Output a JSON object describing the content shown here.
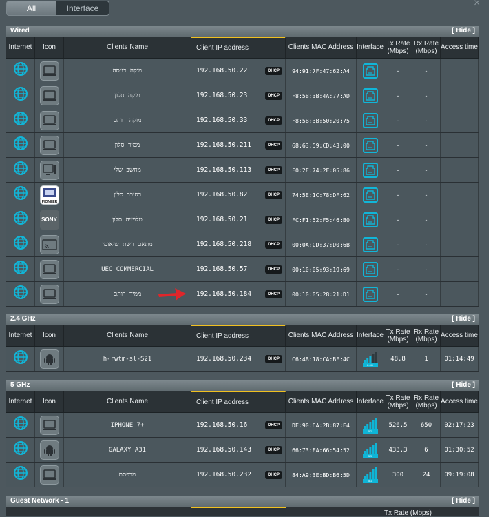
{
  "tabs": [
    "All",
    "Interface"
  ],
  "close_glyph": "×",
  "columns": {
    "internet": "Internet",
    "icon": "Icon",
    "name": "Clients Name",
    "ip": "Client IP address",
    "mac": "Clients MAC Address",
    "interface": "Interface",
    "tx": "Tx Rate (Mbps)",
    "rx": "Rx Rate (Mbps)",
    "access": "Access time"
  },
  "hide_label": "[ Hide ]",
  "dhcp_label": "DHCP",
  "sections": [
    {
      "title": "Wired",
      "clients": [
        {
          "name": "מוקה כניסה",
          "ip": "192.168.50.22",
          "mac": "94:91:7F:47:62:A4",
          "icon": "laptop-icon",
          "tx": "-",
          "rx": "-",
          "access": ""
        },
        {
          "name": "מוקה סלון",
          "ip": "192.168.50.23",
          "mac": "F8:5B:3B:4A:77:AD",
          "icon": "laptop-icon",
          "tx": "-",
          "rx": "-",
          "access": ""
        },
        {
          "name": "מוקה רותם",
          "ip": "192.168.50.33",
          "mac": "F8:5B:3B:50:20:75",
          "icon": "laptop-icon",
          "tx": "-",
          "rx": "-",
          "access": ""
        },
        {
          "name": "ממיר סלון",
          "ip": "192.168.50.211",
          "mac": "68:63:59:CD:43:00",
          "icon": "laptop-icon",
          "tx": "-",
          "rx": "-",
          "access": ""
        },
        {
          "name": "מחשב שלי",
          "ip": "192.168.50.113",
          "mac": "F0:2F:74:2F:05:86",
          "icon": "desktop-icon",
          "tx": "-",
          "rx": "-",
          "access": ""
        },
        {
          "name": "רסיבר סלון",
          "ip": "192.168.50.82",
          "mac": "74:5E:1C:78:DF:62",
          "icon": "pioneer-icon",
          "tx": "-",
          "rx": "-",
          "access": ""
        },
        {
          "name": "טלויזיה סלון",
          "ip": "192.168.50.21",
          "mac": "FC:F1:52:F5:46:B0",
          "icon": "sony-icon",
          "tx": "-",
          "rx": "-",
          "access": ""
        },
        {
          "name": "מתאם רשת שיאומי",
          "ip": "192.168.50.218",
          "mac": "00:0A:CD:37:D0:6B",
          "icon": "cast-icon",
          "tx": "-",
          "rx": "-",
          "access": ""
        },
        {
          "name": "UEC COMMERCIAL",
          "ip": "192.168.50.57",
          "mac": "00:10:05:93:19:69",
          "icon": "laptop-icon",
          "tx": "-",
          "rx": "-",
          "access": ""
        },
        {
          "name": "ממיר רותם",
          "ip": "192.168.50.184",
          "mac": "00:10:05:28:21:D1",
          "icon": "laptop-icon",
          "tx": "-",
          "rx": "-",
          "access": ""
        }
      ]
    },
    {
      "title": "2.4 GHz",
      "clients": [
        {
          "name": "h-rwtm-sl-S21",
          "ip": "192.168.50.234",
          "mac": "C6:4B:18:CA:BF:4C",
          "icon": "android-icon",
          "tx": "48.8",
          "rx": "1",
          "access": "01:14:49",
          "band": "2.4G"
        }
      ]
    },
    {
      "title": "5 GHz",
      "clients": [
        {
          "name": "IPHONE 7+",
          "ip": "192.168.50.16",
          "mac": "DE:90:6A:2B:87:E4",
          "icon": "laptop-icon",
          "tx": "526.5",
          "rx": "650",
          "access": "02:17:23",
          "band": "5G"
        },
        {
          "name": "GALAXY A31",
          "ip": "192.168.50.143",
          "mac": "66:73:FA:66:54:52",
          "icon": "android-icon",
          "tx": "433.3",
          "rx": "6",
          "access": "01:30:52",
          "band": "5G"
        },
        {
          "name": "מדפסת",
          "ip": "192.168.50.232",
          "mac": "84:A9:3E:BD:B6:5D",
          "icon": "laptop-icon",
          "tx": "300",
          "rx": "24",
          "access": "09:19:08",
          "band": "5G"
        }
      ]
    },
    {
      "title": "Guest Network - 1",
      "clients": []
    }
  ],
  "pioneer_text": "PIONEER",
  "sony_text": "SONY",
  "colors": {
    "accent": "#11b6d8",
    "ip_header_underline": "#f0c020",
    "arrow": "#e0262a"
  }
}
